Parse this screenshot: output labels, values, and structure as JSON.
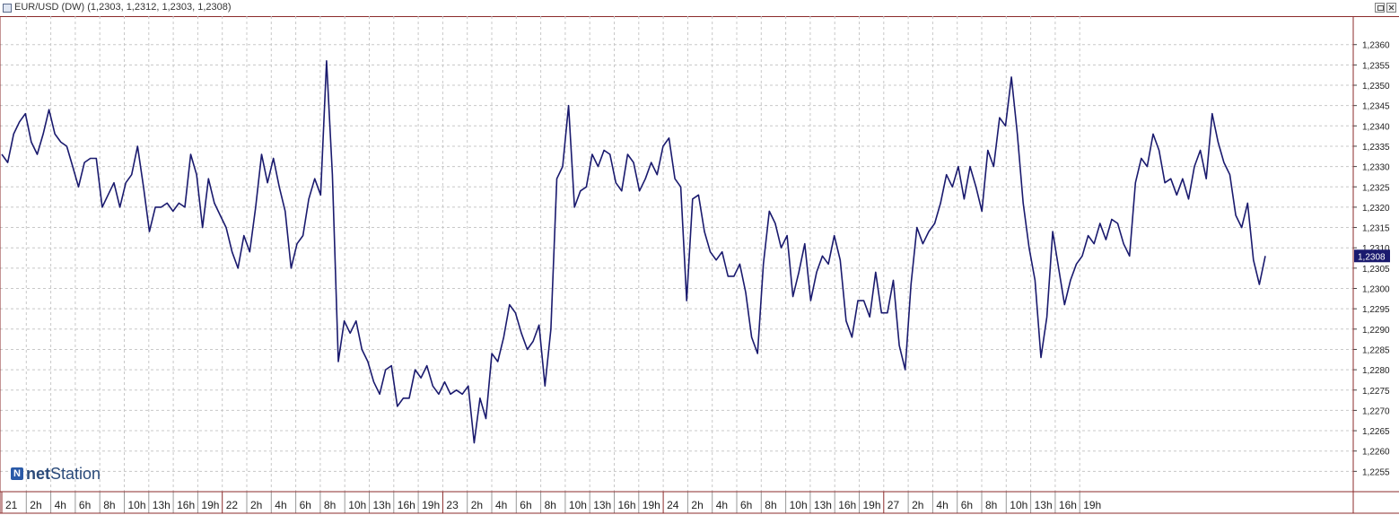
{
  "window": {
    "title": "EUR/USD (DW) (1,2303, 1,2312, 1,2303, 1,2308)",
    "logo_net": "net",
    "logo_station": "Station"
  },
  "colors": {
    "line": "#1a1a6e",
    "grid": "#c8c8c8",
    "border": "#8b2b2b",
    "current_label_bg": "#1a1a6e"
  },
  "chart_data": {
    "type": "line",
    "title": "EUR/USD (DW)",
    "ylim": [
      1.225,
      1.2367
    ],
    "yticks": [
      "1,2255",
      "1,2260",
      "1,2265",
      "1,2270",
      "1,2275",
      "1,2280",
      "1,2285",
      "1,2290",
      "1,2295",
      "1,2300",
      "1,2305",
      "1,2310",
      "1,2315",
      "1,2320",
      "1,2325",
      "1,2330",
      "1,2335",
      "1,2340",
      "1,2345",
      "1,2350",
      "1,2355",
      "1,2360"
    ],
    "current_value_label": "1,2308",
    "current_value": 1.2308,
    "x_tick_labels": [
      "21",
      "2h",
      "4h",
      "6h",
      "8h",
      "10h",
      "13h",
      "16h",
      "19h",
      "22",
      "2h",
      "4h",
      "6h",
      "8h",
      "10h",
      "13h",
      "16h",
      "19h",
      "23",
      "2h",
      "4h",
      "6h",
      "8h",
      "10h",
      "13h",
      "16h",
      "19h",
      "24",
      "2h",
      "4h",
      "6h",
      "8h",
      "10h",
      "13h",
      "16h",
      "19h",
      "27",
      "2h",
      "4h",
      "6h",
      "8h",
      "10h",
      "13h",
      "16h",
      "19h"
    ],
    "grid": true,
    "series": [
      {
        "values": [
          1.2333,
          1.2331,
          1.2338,
          1.2341,
          1.2343,
          1.2336,
          1.2333,
          1.2338,
          1.2344,
          1.2338,
          1.2336,
          1.2335,
          1.233,
          1.2325,
          1.2331,
          1.2332,
          1.2332,
          1.232,
          1.2323,
          1.2326,
          1.232,
          1.2326,
          1.2328,
          1.2335,
          1.2325,
          1.2314,
          1.232,
          1.232,
          1.2321,
          1.2319,
          1.2321,
          1.232,
          1.2333,
          1.2328,
          1.2315,
          1.2327,
          1.2321,
          1.2318,
          1.2315,
          1.2309,
          1.2305,
          1.2313,
          1.2309,
          1.232,
          1.2333,
          1.2326,
          1.2332,
          1.2325,
          1.2319,
          1.2305,
          1.2311,
          1.2313,
          1.2322,
          1.2327,
          1.2323,
          1.2356,
          1.2328,
          1.2282,
          1.2292,
          1.2289,
          1.2292,
          1.2285,
          1.2282,
          1.2277,
          1.2274,
          1.228,
          1.2281,
          1.2271,
          1.2273,
          1.2273,
          1.228,
          1.2278,
          1.2281,
          1.2276,
          1.2274,
          1.2277,
          1.2274,
          1.2275,
          1.2274,
          1.2276,
          1.2262,
          1.2273,
          1.2268,
          1.2284,
          1.2282,
          1.2288,
          1.2296,
          1.2294,
          1.2289,
          1.2285,
          1.2287,
          1.2291,
          1.2276,
          1.229,
          1.2327,
          1.233,
          1.2345,
          1.232,
          1.2324,
          1.2325,
          1.2333,
          1.233,
          1.2334,
          1.2333,
          1.2326,
          1.2324,
          1.2333,
          1.2331,
          1.2324,
          1.2327,
          1.2331,
          1.2328,
          1.2335,
          1.2337,
          1.2327,
          1.2325,
          1.2297,
          1.2322,
          1.2323,
          1.2314,
          1.2309,
          1.2307,
          1.2309,
          1.2303,
          1.2303,
          1.2306,
          1.2299,
          1.2288,
          1.2284,
          1.2306,
          1.2319,
          1.2316,
          1.231,
          1.2313,
          1.2298,
          1.2304,
          1.2311,
          1.2297,
          1.2304,
          1.2308,
          1.2306,
          1.2313,
          1.2307,
          1.2292,
          1.2288,
          1.2297,
          1.2297,
          1.2293,
          1.2304,
          1.2294,
          1.2294,
          1.2302,
          1.2286,
          1.228,
          1.2301,
          1.2315,
          1.2311,
          1.2314,
          1.2316,
          1.2321,
          1.2328,
          1.2325,
          1.233,
          1.2322,
          1.233,
          1.2325,
          1.2319,
          1.2334,
          1.233,
          1.2342,
          1.234,
          1.2352,
          1.2338,
          1.2321,
          1.231,
          1.2302,
          1.2283,
          1.2293,
          1.2314,
          1.2305,
          1.2296,
          1.2302,
          1.2306,
          1.2308,
          1.2313,
          1.2311,
          1.2316,
          1.2312,
          1.2317,
          1.2316,
          1.2311,
          1.2308,
          1.2326,
          1.2332,
          1.233,
          1.2338,
          1.2334,
          1.2326,
          1.2327,
          1.2323,
          1.2327,
          1.2322,
          1.233,
          1.2334,
          1.2327,
          1.2343,
          1.2336,
          1.2331,
          1.2328,
          1.2318,
          1.2315,
          1.2321,
          1.2307,
          1.2301,
          1.2308
        ]
      }
    ]
  }
}
